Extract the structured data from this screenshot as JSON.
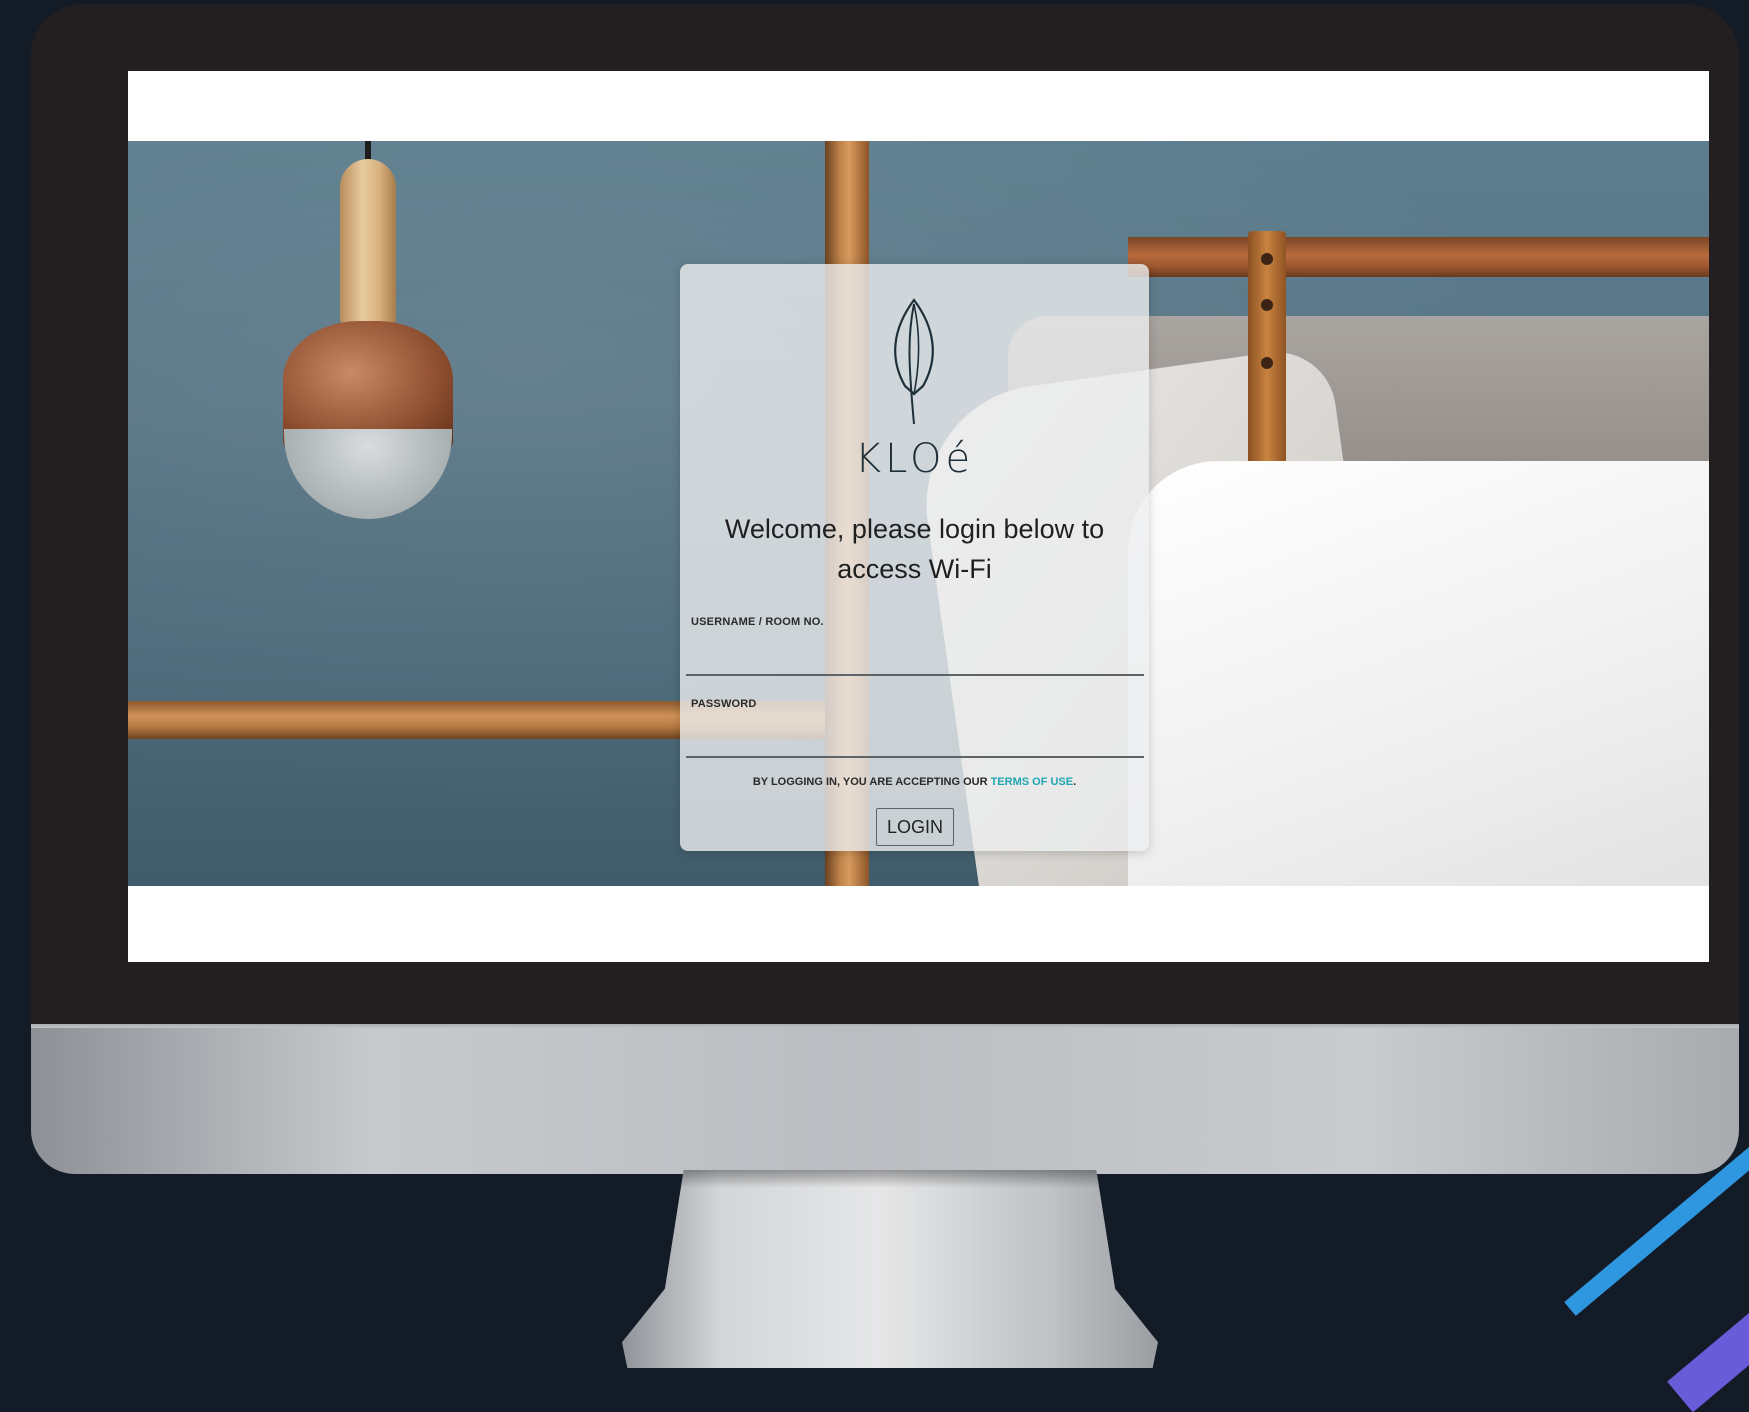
{
  "brand": {
    "name": "KLOé",
    "logo_icon": "leaf-icon"
  },
  "login": {
    "welcome": "Welcome, please login below to access Wi-Fi",
    "username_label": "USERNAME / ROOM NO.",
    "username_value": "",
    "password_label": "PASSWORD",
    "password_value": "",
    "terms_prefix": "BY LOGGING IN, YOU ARE ACCEPTING OUR ",
    "terms_link": "TERMS OF USE",
    "terms_suffix": ".",
    "button_label": "LOGIN"
  },
  "colors": {
    "accent_link": "#20a5b3",
    "brand_text": "#1e2f3a",
    "wall": "#587585",
    "bezel": "#231f20",
    "background": "#121b26"
  }
}
